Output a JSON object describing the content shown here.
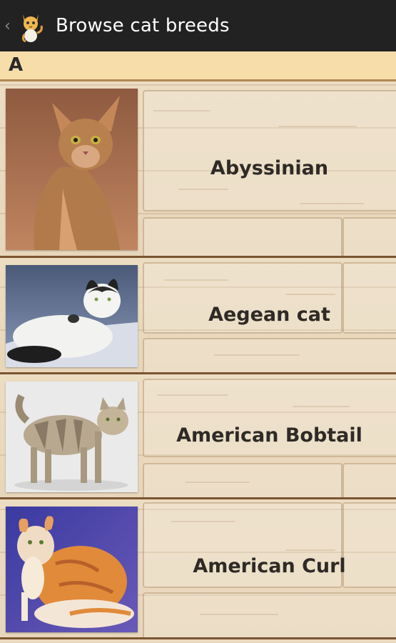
{
  "action_bar": {
    "back_icon": "chevron-left-icon",
    "app_icon": "cat-icon",
    "title": "Browse cat breeds"
  },
  "section": {
    "letter": "A"
  },
  "breeds": [
    {
      "name": "Abyssinian",
      "photo": "abyssinian-cat-photo"
    },
    {
      "name": "Aegean cat",
      "photo": "aegean-cat-photo"
    },
    {
      "name": "American Bobtail",
      "photo": "american-bobtail-cat-photo"
    },
    {
      "name": "American Curl",
      "photo": "american-curl-cat-photo"
    }
  ],
  "colors": {
    "action_bar": "#222222",
    "section_header": "#f7ddaa",
    "row_background": "#ecdcc2",
    "row_divider": "#7a5530"
  }
}
